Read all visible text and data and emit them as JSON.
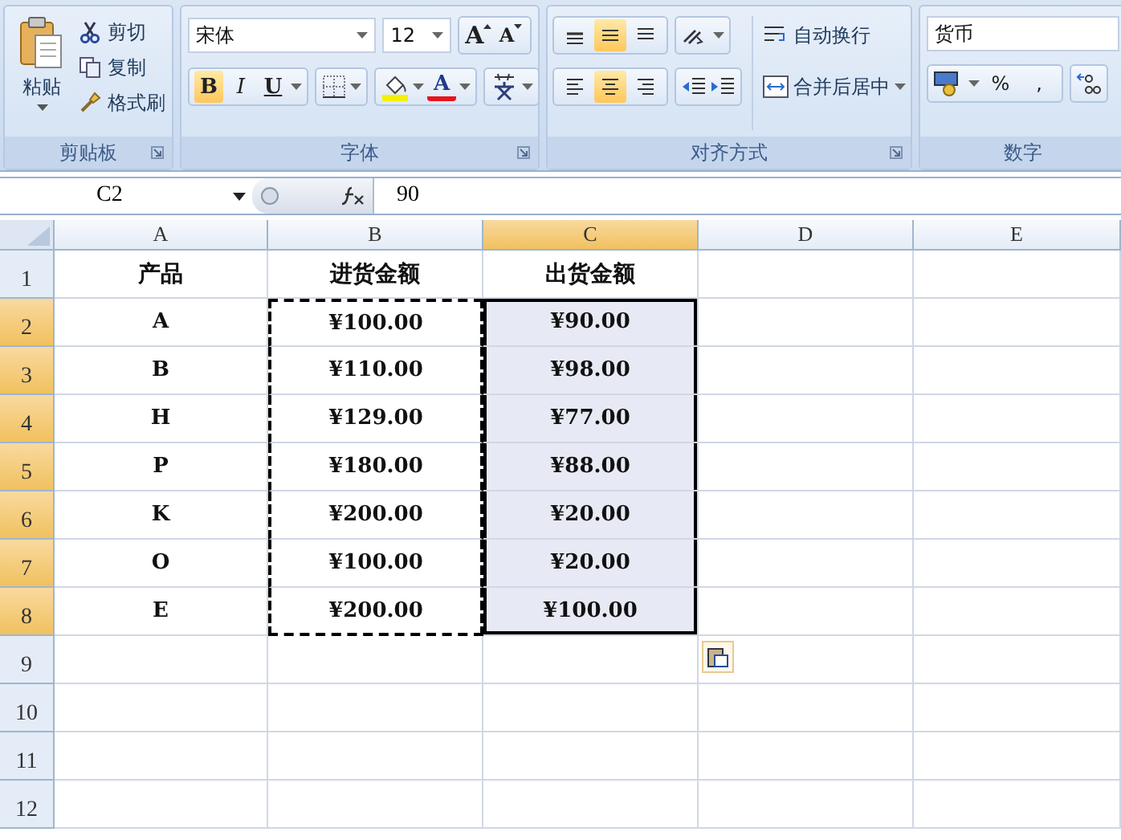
{
  "ribbon": {
    "clipboard": {
      "title": "剪贴板",
      "paste": "粘贴",
      "cut": "剪切",
      "copy": "复制",
      "format_painter": "格式刷"
    },
    "font": {
      "title": "字体",
      "font_name": "宋体",
      "font_size": "12",
      "grow": "A",
      "shrink": "A",
      "bold": {
        "label": "B",
        "selected": true
      },
      "italic": {
        "label": "I",
        "selected": false
      },
      "underline": {
        "label": "U",
        "selected": false
      },
      "font_color": {
        "label": "A",
        "color": "#e8141c"
      },
      "fill": {
        "color": "#f5f000"
      }
    },
    "alignment": {
      "title": "对齐方式",
      "vertical": [
        {
          "kind": "top",
          "selected": false
        },
        {
          "kind": "middle",
          "selected": true
        },
        {
          "kind": "bottom",
          "selected": false
        }
      ],
      "horizontal": [
        {
          "kind": "left",
          "selected": false
        },
        {
          "kind": "center",
          "selected": true
        },
        {
          "kind": "right",
          "selected": false
        }
      ],
      "wrap_text": "自动换行",
      "merge_center": "合并后居中"
    },
    "number": {
      "title": "数字",
      "format": "货币",
      "percent": "%",
      "comma": ","
    }
  },
  "formula_bar": {
    "name_box": "C2",
    "formula": "90"
  },
  "sheet": {
    "columns": [
      {
        "label": "A",
        "selected": false
      },
      {
        "label": "B",
        "selected": false
      },
      {
        "label": "C",
        "selected": true
      },
      {
        "label": "D",
        "selected": false
      },
      {
        "label": "E",
        "selected": false
      }
    ],
    "rows": [
      {
        "number": "1",
        "selected": false,
        "cells": [
          {
            "text": "产品",
            "selected": false,
            "copied": false
          },
          {
            "text": "进货金额",
            "selected": false,
            "copied": false
          },
          {
            "text": "出货金额",
            "selected": false,
            "copied": false
          }
        ]
      },
      {
        "number": "2",
        "selected": true,
        "cells": [
          {
            "text": "A",
            "selected": false,
            "copied": false
          },
          {
            "text": "¥100.00",
            "selected": false,
            "copied": true
          },
          {
            "text": "¥90.00",
            "selected": true,
            "copied": false
          }
        ]
      },
      {
        "number": "3",
        "selected": true,
        "cells": [
          {
            "text": "B",
            "selected": false,
            "copied": false
          },
          {
            "text": "¥110.00",
            "selected": false,
            "copied": true
          },
          {
            "text": "¥98.00",
            "selected": true,
            "copied": false
          }
        ]
      },
      {
        "number": "4",
        "selected": true,
        "cells": [
          {
            "text": "H",
            "selected": false,
            "copied": false
          },
          {
            "text": "¥129.00",
            "selected": false,
            "copied": true
          },
          {
            "text": "¥77.00",
            "selected": true,
            "copied": false
          }
        ]
      },
      {
        "number": "5",
        "selected": true,
        "cells": [
          {
            "text": "P",
            "selected": false,
            "copied": false
          },
          {
            "text": "¥180.00",
            "selected": false,
            "copied": true
          },
          {
            "text": "¥88.00",
            "selected": true,
            "copied": false
          }
        ]
      },
      {
        "number": "6",
        "selected": true,
        "cells": [
          {
            "text": "K",
            "selected": false,
            "copied": false
          },
          {
            "text": "¥200.00",
            "selected": false,
            "copied": true
          },
          {
            "text": "¥20.00",
            "selected": true,
            "copied": false
          }
        ]
      },
      {
        "number": "7",
        "selected": true,
        "cells": [
          {
            "text": "O",
            "selected": false,
            "copied": false
          },
          {
            "text": "¥100.00",
            "selected": false,
            "copied": true
          },
          {
            "text": "¥20.00",
            "selected": true,
            "copied": false
          }
        ]
      },
      {
        "number": "8",
        "selected": true,
        "cells": [
          {
            "text": "E",
            "selected": false,
            "copied": false
          },
          {
            "text": "¥200.00",
            "selected": false,
            "copied": true
          },
          {
            "text": "¥100.00",
            "selected": true,
            "copied": false
          }
        ]
      },
      {
        "number": "9",
        "selected": false,
        "cells": []
      },
      {
        "number": "10",
        "selected": false,
        "cells": []
      },
      {
        "number": "11",
        "selected": false,
        "cells": []
      },
      {
        "number": "12",
        "selected": false,
        "cells": []
      }
    ]
  }
}
